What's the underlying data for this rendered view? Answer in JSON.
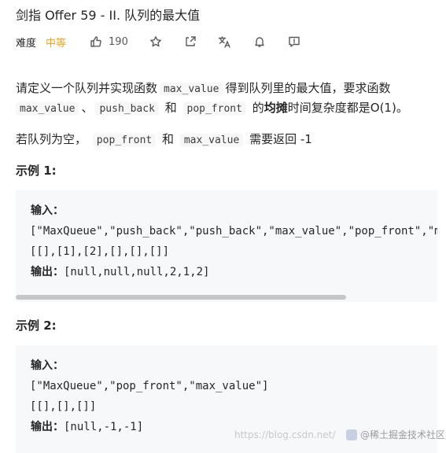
{
  "header": {
    "title": "剑指 Offer 59 - II. 队列的最大值",
    "difficulty_label": "难度",
    "difficulty_value": "中等",
    "likes": "190",
    "icons": [
      "thumbs-up-icon",
      "star-icon",
      "share-icon",
      "translate-icon",
      "bell-icon",
      "feedback-icon"
    ],
    "accent_color": "#ffa116"
  },
  "description": {
    "line1_a": "请定义一个队列并实现函数",
    "line1_code": "max_value",
    "line1_b": "得到队列里的最大值，要求函数",
    "line2_code1": "max_value",
    "line2_sep": "、",
    "line2_code2": "push_back",
    "line2_and": "和",
    "line2_code3": "pop_front",
    "line2_de": "的",
    "line2_bold": "均摊",
    "line2_rest": "时间复杂度都是O(1)。",
    "line3_a": "若队列为空，",
    "line3_code1": "pop_front",
    "line3_and": "和",
    "line3_code2": "max_value",
    "line3_b": "需要返回 -1"
  },
  "examples": [
    {
      "heading": "示例 1:",
      "input_label": "输入：",
      "input_line1": "[\"MaxQueue\",\"push_back\",\"push_back\",\"max_value\",\"pop_front\",\"max_value\"]",
      "input_line2": "[[],[1],[2],[],[],[]]",
      "output_label": "输出：",
      "output_value": "[null,null,null,2,1,2]"
    },
    {
      "heading": "示例 2:",
      "input_label": "输入：",
      "input_line1": "[\"MaxQueue\",\"pop_front\",\"max_value\"]",
      "input_line2": "[[],[],[]]",
      "output_label": "输出：",
      "output_value": "[null,-1,-1]"
    }
  ],
  "watermark": {
    "url_text": "https://blog.csdn.net/",
    "brand_text": "@稀土掘金技术社区"
  }
}
